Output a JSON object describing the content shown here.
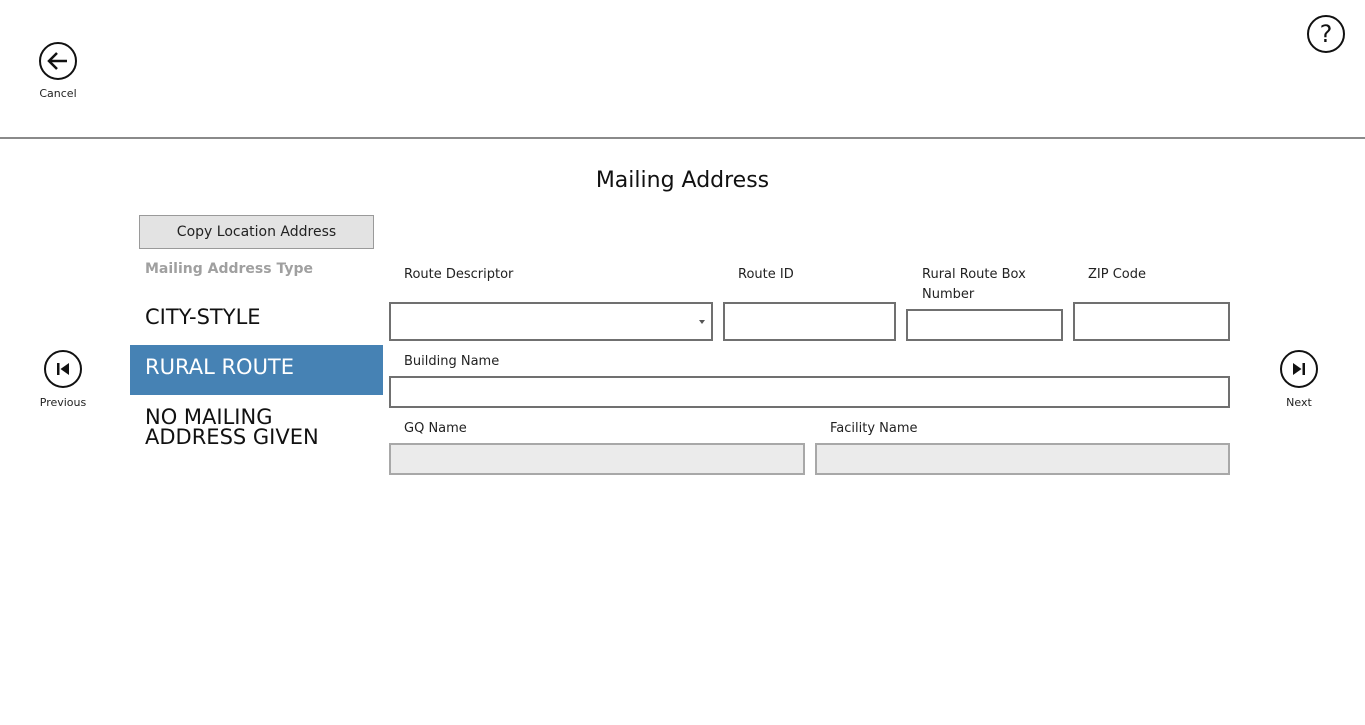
{
  "header": {
    "cancel_label": "Cancel",
    "help_symbol": "?"
  },
  "page_title": "Mailing Address",
  "copy_button_label": "Copy Location Address",
  "mailing_address_type": {
    "label": "Mailing Address Type",
    "options": [
      "CITY-STYLE",
      "RURAL ROUTE",
      "NO MAILING ADDRESS GIVEN"
    ],
    "selected": "RURAL ROUTE"
  },
  "fields": {
    "route_descriptor": {
      "label": "Route Descriptor",
      "value": ""
    },
    "route_id": {
      "label": "Route ID",
      "value": ""
    },
    "rural_route_box_number": {
      "label": "Rural Route Box Number",
      "value": ""
    },
    "zip_code": {
      "label": "ZIP Code",
      "value": ""
    },
    "building_name": {
      "label": "Building Name",
      "value": ""
    },
    "gq_name": {
      "label": "GQ Name",
      "value": ""
    },
    "facility_name": {
      "label": "Facility Name",
      "value": ""
    }
  },
  "navigation": {
    "previous_label": "Previous",
    "next_label": "Next"
  },
  "colors": {
    "selected_bg": "#4682b4",
    "disabled_bg": "#ebebeb"
  }
}
